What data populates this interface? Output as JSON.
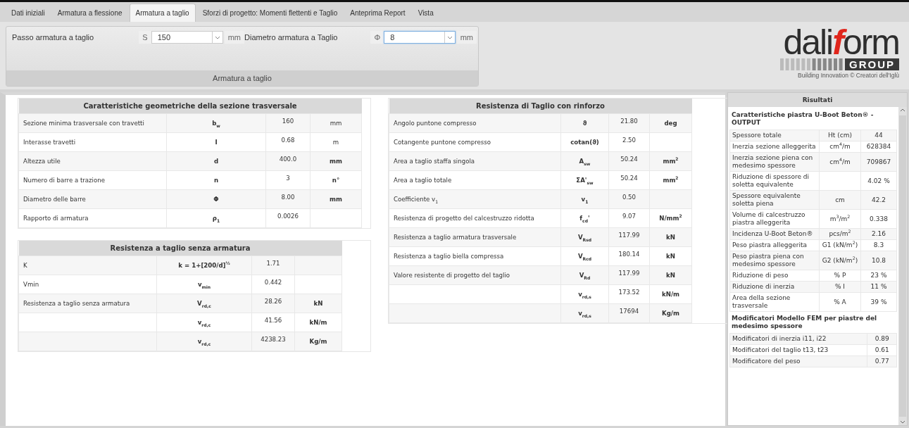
{
  "tabs": [
    {
      "label": "Dati iniziali",
      "selected": false
    },
    {
      "label": "Armatura a flessione",
      "selected": false
    },
    {
      "label": "Armatura a taglio",
      "selected": true
    },
    {
      "label": "Sforzi di progetto: Momenti flettenti e Taglio",
      "selected": false
    },
    {
      "label": "Anteprima Report",
      "selected": false
    },
    {
      "label": "Vista",
      "selected": false
    }
  ],
  "toolbar": {
    "fields": [
      {
        "label": "Passo armatura a taglio",
        "prefix": "S",
        "value": "150",
        "unit": "mm",
        "focused": false
      },
      {
        "label": "Diametro armatura a Taglio",
        "prefix": "Φ",
        "value": "8",
        "unit": "mm",
        "focused": true
      }
    ],
    "caption": "Armatura a taglio"
  },
  "logo": {
    "part_1": "dali",
    "part_2": "f",
    "part_3": "orm",
    "group": "GROUP",
    "tagline": "Building Innovation © Creatori dell'Iglù"
  },
  "tables": [
    {
      "title": "Caratteristiche geometriche della sezione trasversale",
      "rows": [
        {
          "label": "Sezione minima trasversale con travetti",
          "symbol": "b$_{w}$",
          "value": "160",
          "unit": "mm",
          "unit_bold": false
        },
        {
          "label": "Interasse travetti",
          "symbol": "I",
          "value": "0.68",
          "unit": "m",
          "unit_bold": false
        },
        {
          "label": "Altezza utile",
          "symbol": "d",
          "value": "400.0",
          "unit": "mm",
          "unit_bold": true
        },
        {
          "label": "Numero di barre a trazione",
          "symbol": "n",
          "value": "3",
          "unit": "n°",
          "unit_bold": true
        },
        {
          "label": "Diametro delle barre",
          "symbol": "Φ",
          "value": "8.00",
          "unit": "mm",
          "unit_bold": true
        },
        {
          "label": "Rapporto di armatura",
          "symbol": "ρ$_{1}$",
          "value": "0.0026"
        }
      ]
    },
    {
      "title": "Resistenza a taglio senza armatura",
      "rows": [
        {
          "label": "K",
          "symbol": "k = 1+[200/d]$^{½}$",
          "value": "1.71"
        },
        {
          "label": "Vmin",
          "symbol": "v$_{min}$",
          "value": "0.442"
        },
        {
          "label": "Resistenza a taglio senza armatura",
          "symbol": "V$_{rd,c}$",
          "value": "28.26",
          "unit": "kN",
          "unit_bold": true
        },
        {
          "symbol": "v$_{rd,c}$",
          "value": "41.56",
          "unit": "kN/m",
          "unit_bold": true
        },
        {
          "symbol": "v$_{rd,c}$",
          "value": "4238.23",
          "unit": "Kg/m",
          "unit_bold": true
        }
      ]
    },
    {
      "title": "Resistenza di Taglio con rinforzo",
      "rows": [
        {
          "label": "Angolo puntone compresso",
          "symbol": "ϑ",
          "value": "21.80",
          "unit": "deg",
          "unit_bold": true
        },
        {
          "label": "Cotangente puntone compresso",
          "symbol": "cotan(ϑ)",
          "value": "2.50"
        },
        {
          "label": "Area a taglio staffa singola",
          "symbol": "A$_{sw}$",
          "value": "50.24",
          "unit": "mm$^{2}$",
          "unit_bold": true
        },
        {
          "label": "Area a taglio totale",
          "symbol": "ΣA'$_{sw}$",
          "value": "50.24",
          "unit": "mm$^{2}$",
          "unit_bold": true
        },
        {
          "label": "Coefficiente v$_{1}$",
          "symbol": "v$_{1}$",
          "value": "0.50"
        },
        {
          "label": "Resistenza di progetto del calcestruzzo ridotta",
          "symbol": "f$_{cd}$'",
          "value": "9.07",
          "unit": "N/mm$^{2}$",
          "unit_bold": true
        },
        {
          "label": "Resistenza a taglio armatura trasversale",
          "symbol": "V$_{Rsd}$",
          "value": "117.99",
          "unit": "kN",
          "unit_bold": true
        },
        {
          "label": "Resistenza a taglio biella compressa",
          "symbol": "V$_{Rcd}$",
          "value": "180.14",
          "unit": "kN",
          "unit_bold": true
        },
        {
          "label": "Valore resistente di progetto del taglio",
          "symbol": "V$_{Rd}$",
          "value": "117.99",
          "unit": "kN",
          "unit_bold": true
        },
        {
          "symbol": "v$_{rd,s}$",
          "value": "173.52",
          "unit": "kN/m",
          "unit_bold": true
        },
        {
          "symbol": "v$_{rd,s}$",
          "value": "17694",
          "unit": "Kg/m",
          "unit_bold": true
        }
      ]
    }
  ],
  "results": {
    "title": "Risultati",
    "sections": [
      {
        "heading": "Caratteristiche piastra U-Boot Beton® - OUTPUT",
        "rows": [
          {
            "label": "Spessore totale",
            "unit": "Ht (cm)",
            "value": "44"
          },
          {
            "label": "Inerzia sezione alleggerita",
            "unit": "cm$^{4}$/m",
            "value": "628384"
          },
          {
            "label": "Inerzia sezione piena con medesimo spessore",
            "unit": "cm$^{4}$/m",
            "value": "709867"
          },
          {
            "label": "Riduzione di spessore di soletta equivalente",
            "value": "4.02 %"
          },
          {
            "label": "Spessore equivalente soletta piena",
            "unit": "cm",
            "value": "42.2"
          },
          {
            "label": "Volume di calcestruzzo piastra alleggerita",
            "unit": "m$^{3}$/m$^{2}$",
            "value": "0.338"
          },
          {
            "label": "Incidenza U-Boot Beton®",
            "unit": "pcs/m$^{2}$",
            "value": "2.16"
          },
          {
            "label": "Peso piastra alleggerita",
            "unit": "G1 (kN/m$^{2}$)",
            "value": "8.3"
          },
          {
            "label": "Peso piastra piena con medesimo spessore",
            "unit": "G2 (kN/m$^{2}$)",
            "value": "10.8"
          },
          {
            "label": "Riduzione di peso",
            "unit": "% P",
            "value": "23 %"
          },
          {
            "label": "Riduzione di inerzia",
            "unit": "% I",
            "value": "11 %"
          },
          {
            "label": "Area della sezione trasversale",
            "unit": "% A",
            "value": "39 %"
          }
        ]
      },
      {
        "heading": "Modificatori Modello FEM per piastre del medesimo spessore",
        "rows": [
          {
            "label": "Modificatori di inerzia i11, i22",
            "value": "0.89"
          },
          {
            "label": "Modificatori del taglio t13, t23",
            "value": "0.61"
          },
          {
            "label": "Modificatore del peso",
            "value": "0.77"
          }
        ]
      }
    ]
  }
}
